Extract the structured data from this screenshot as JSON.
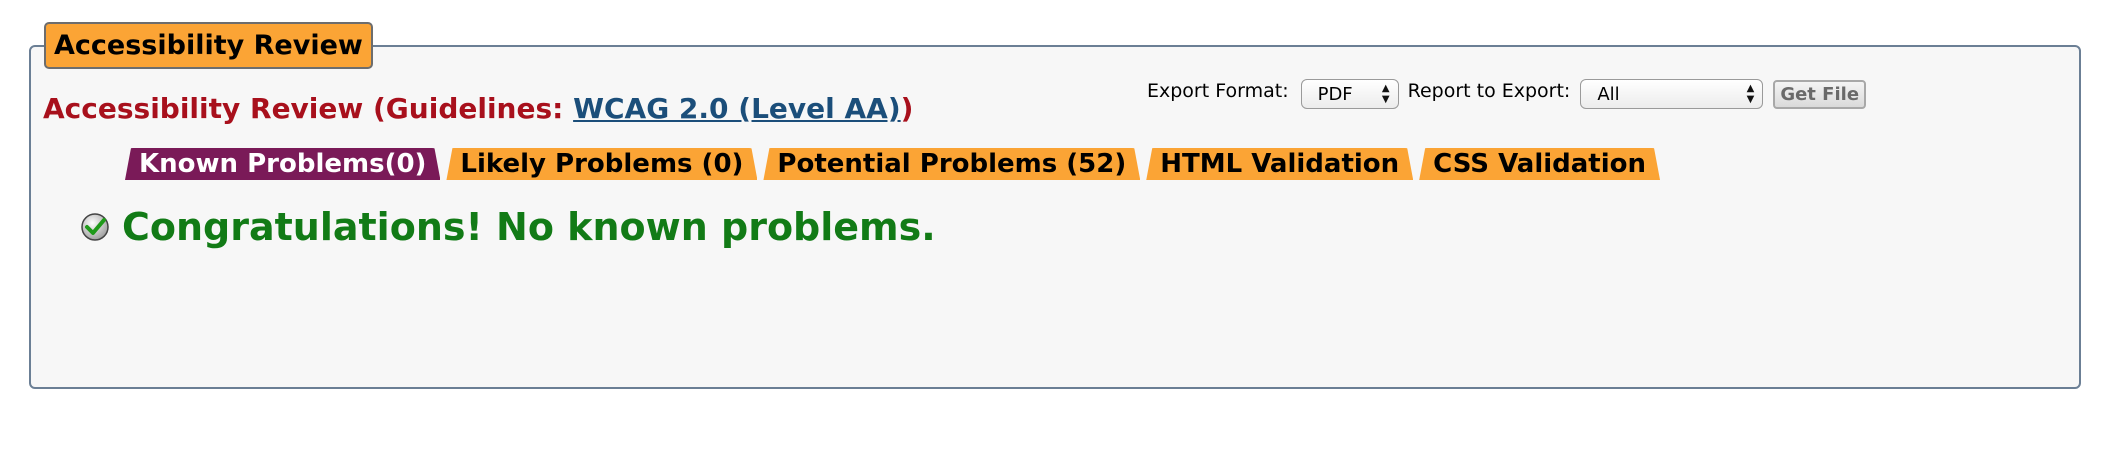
{
  "legend": "Accessibility Review",
  "review": {
    "prefix": "Accessibility Review (Guidelines: ",
    "link": "WCAG 2.0 (Level AA)",
    "suffix": ")"
  },
  "export": {
    "format_label": "Export Format:",
    "format_value": "PDF",
    "report_label": "Report to Export:",
    "report_value": "All",
    "button": "Get File"
  },
  "tabs": [
    {
      "label": "Known Problems(0)",
      "active": true
    },
    {
      "label": "Likely Problems (0)",
      "active": false
    },
    {
      "label": "Potential Problems (52)",
      "active": false
    },
    {
      "label": "HTML Validation",
      "active": false
    },
    {
      "label": "CSS Validation",
      "active": false
    }
  ],
  "message": "Congratulations! No known problems.",
  "icons": {
    "check": "check-circle-icon",
    "select_arrows": "updown-arrows-icon"
  },
  "colors": {
    "tab_orange": "#fba435",
    "tab_active": "#7a1a58",
    "title_red": "#a8101c",
    "link_blue": "#1b4e7a",
    "success_green": "#127b16"
  }
}
